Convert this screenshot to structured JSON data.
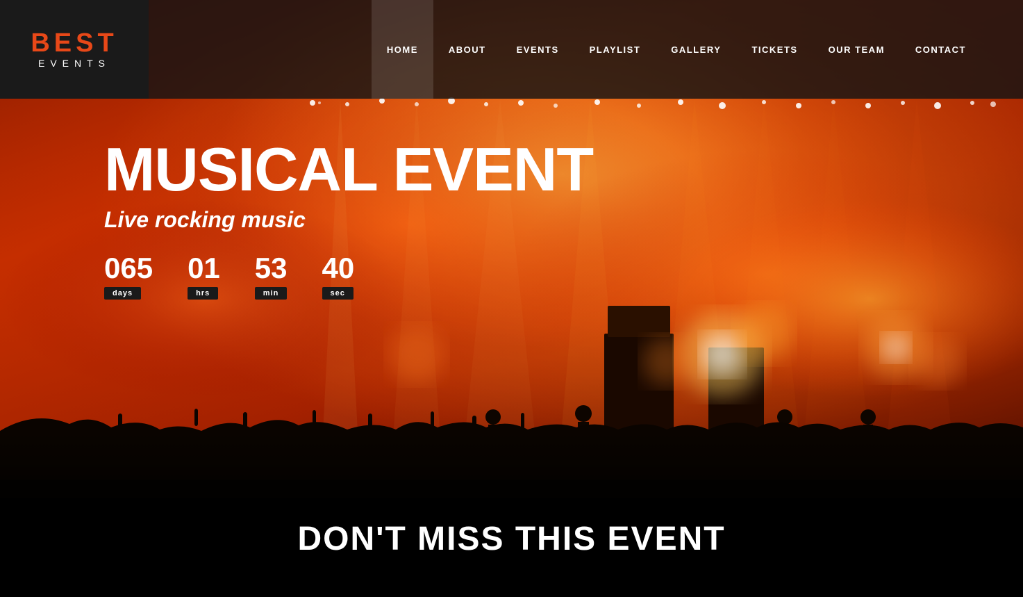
{
  "header": {
    "logo_best": "BEST",
    "logo_events": "EVENTS",
    "nav_items": [
      {
        "label": "HOME",
        "active": true
      },
      {
        "label": "ABOUT",
        "active": false
      },
      {
        "label": "EVENTS",
        "active": false
      },
      {
        "label": "PLAYLIST",
        "active": false
      },
      {
        "label": "GALLERY",
        "active": false
      },
      {
        "label": "TICKETS",
        "active": false
      },
      {
        "label": "OUR TEAM",
        "active": false
      },
      {
        "label": "CONTACT",
        "active": false
      }
    ]
  },
  "hero": {
    "title": "MUSICAL EVENT",
    "subtitle": "Live rocking music",
    "countdown": {
      "days_value": "065",
      "days_label": "days",
      "hrs_value": "01",
      "hrs_label": "hrs",
      "min_value": "53",
      "min_label": "min",
      "sec_value": "40",
      "sec_label": "sec"
    }
  },
  "bottom": {
    "title": "Don't Miss This Event"
  },
  "colors": {
    "accent": "#e84818",
    "logo_bg": "#1a1a1a",
    "nav_bg": "rgba(20,20,20,0.82)"
  }
}
